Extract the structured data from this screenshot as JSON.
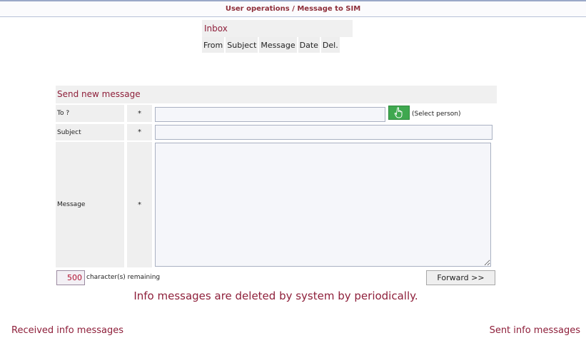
{
  "header": {
    "breadcrumb": "User operations / Message to SIM"
  },
  "inbox": {
    "title": "Inbox",
    "columns": [
      "From",
      "Subject",
      "Message",
      "Date",
      "Del."
    ]
  },
  "compose": {
    "title": "Send new message",
    "to_label": "To ?",
    "subject_label": "Subject",
    "message_label": "Message",
    "required_mark": "*",
    "select_person_label": "(Select person)",
    "to_value": "",
    "subject_value": "",
    "message_value": "",
    "chars_remaining": "500",
    "chars_remaining_label": "character(s) remaining",
    "forward_label": "Forward >>"
  },
  "info_note": "Info messages are deleted by system by periodically.",
  "links": {
    "received": "Received info messages",
    "sent": "Sent info messages"
  },
  "colors": {
    "accent": "#8e1f3a",
    "select_button": "#3fa84f"
  }
}
